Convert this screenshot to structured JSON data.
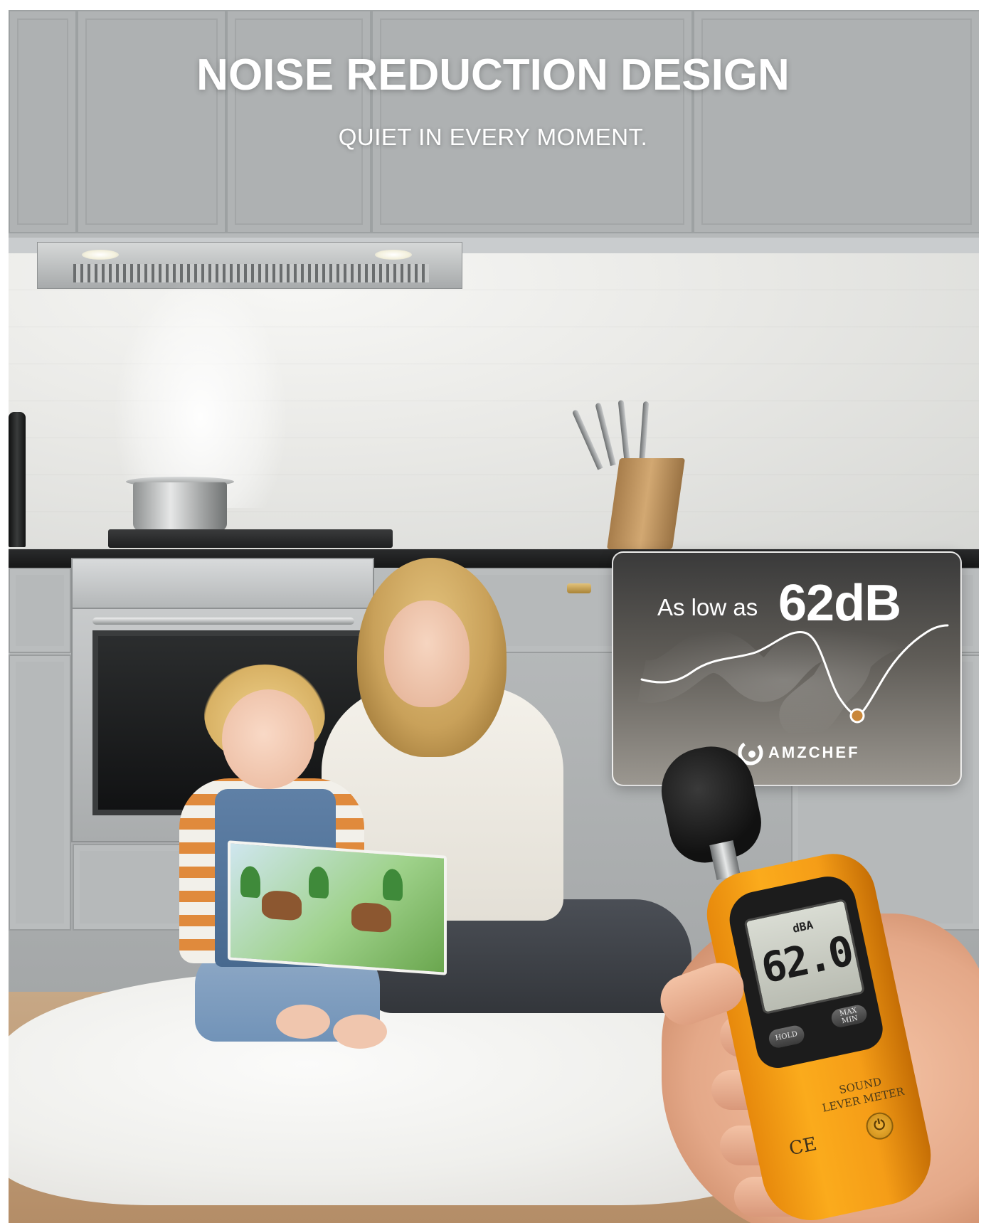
{
  "headline": {
    "title": "NOISE REDUCTION DESIGN",
    "subtitle": "QUIET IN EVERY MOMENT."
  },
  "callout": {
    "prefix": "As low as",
    "value": "62dB",
    "brand": "AMZCHEF",
    "curve_color": "#ffffff",
    "marker_color": "#c9873a"
  },
  "sound_meter": {
    "unit": "dBA",
    "reading": "62.0",
    "hold_label": "HOLD",
    "maxmin_label_top": "MAX",
    "maxmin_label_bottom": "MIN",
    "device_label_line1": "SOUND",
    "device_label_line2": "LEVER METER",
    "ce_mark": "CE",
    "power_icon": "power-icon",
    "body_color": "#f9a51a"
  },
  "colors": {
    "headline_text": "#ffffff",
    "cabinet_gray": "#aeb1b2",
    "counter_black": "#1c1d1e"
  }
}
